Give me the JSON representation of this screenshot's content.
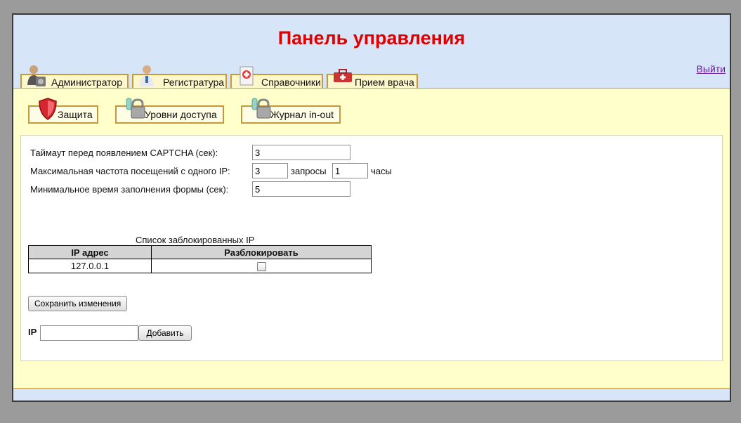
{
  "header": {
    "title": "Панель управления",
    "logout_label": "Выйти"
  },
  "tabs": [
    {
      "label": "Администратор",
      "icon": "admin-user-icon"
    },
    {
      "label": "Регистратура",
      "icon": "receptionist-icon"
    },
    {
      "label": "Справочники",
      "icon": "medical-reference-icon"
    },
    {
      "label": "Прием врача",
      "icon": "medical-case-icon"
    }
  ],
  "subtabs": [
    {
      "label": "Защита",
      "icon": "shield-icon"
    },
    {
      "label": "Уровни доступа",
      "icon": "lock-key-icon"
    },
    {
      "label": "Журнал in-out",
      "icon": "lock-key-icon"
    }
  ],
  "settings": {
    "captcha_timeout_label": "Таймаут перед появлением CAPTCHA (сек):",
    "captcha_timeout_value": "3",
    "max_rate_label": "Максимальная частота посещений с одного IP:",
    "max_rate_requests_value": "3",
    "requests_label": "запросы",
    "max_rate_hours_value": "1",
    "hours_label": "часы",
    "min_fill_label": "Минимальное время заполнения формы (сек):",
    "min_fill_value": "5"
  },
  "blocked": {
    "caption": "Список заблокированных IP",
    "columns": [
      "IP адрес",
      "Разблокировать"
    ],
    "rows": [
      {
        "ip": "127.0.0.1",
        "unblock_checked": false
      }
    ]
  },
  "actions": {
    "save_label": "Сохранить изменения",
    "ip_label": "IP",
    "ip_input_value": "",
    "add_label": "Добавить"
  }
}
